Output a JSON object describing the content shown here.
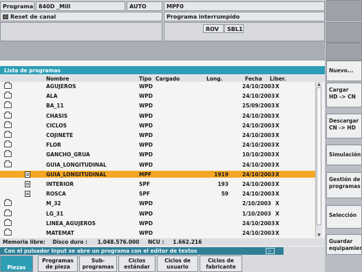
{
  "header": {
    "label_programa": "Programa",
    "machine": "840D _Mill",
    "mode": "AUTO",
    "program_name": "MPF0",
    "channel_reset": "Reset de canal",
    "status": "Programa interrumpido",
    "flag_rov": "ROV",
    "flag_sbl": "SBL1"
  },
  "panel": {
    "title": "Lista de programas",
    "columns": [
      "Nombre",
      "Tipo",
      "Cargado",
      "Long.",
      "Fecha",
      "Liber."
    ],
    "rows": [
      {
        "name": "AGUJEROS",
        "type": "WPD",
        "loaded": "",
        "length": "",
        "date": "24/10/2003",
        "release": "X",
        "kind": "folder"
      },
      {
        "name": "ALA",
        "type": "WPD",
        "loaded": "",
        "length": "",
        "date": "24/10/2003",
        "release": "X",
        "kind": "folder"
      },
      {
        "name": "BA_11",
        "type": "WPD",
        "loaded": "",
        "length": "",
        "date": "25/09/2003",
        "release": "X",
        "kind": "folder"
      },
      {
        "name": "CHASIS",
        "type": "WPD",
        "loaded": "",
        "length": "",
        "date": "24/10/2003",
        "release": "X",
        "kind": "folder"
      },
      {
        "name": "CICLOS",
        "type": "WPD",
        "loaded": "",
        "length": "",
        "date": "24/10/2003",
        "release": "X",
        "kind": "folder"
      },
      {
        "name": "COJINETE",
        "type": "WPD",
        "loaded": "",
        "length": "",
        "date": "24/10/2003",
        "release": "X",
        "kind": "folder"
      },
      {
        "name": "FLOR",
        "type": "WPD",
        "loaded": "",
        "length": "",
        "date": "24/10/2003",
        "release": "X",
        "kind": "folder"
      },
      {
        "name": "GANCHO_GRUA",
        "type": "WPD",
        "loaded": "",
        "length": "",
        "date": "10/10/2003",
        "release": "X",
        "kind": "folder"
      },
      {
        "name": "GUIA_LONGITUDINAL",
        "type": "WPD",
        "loaded": "",
        "length": "",
        "date": "24/10/2003",
        "release": "X",
        "kind": "folder-open"
      },
      {
        "name": "GUIA_LONGITUDINAL",
        "type": "MPF",
        "loaded": "",
        "length": "1919",
        "date": "24/10/2003",
        "release": "X",
        "kind": "file",
        "selected": true
      },
      {
        "name": "INTERIOR",
        "type": "SPF",
        "loaded": "",
        "length": "193",
        "date": "24/10/2003",
        "release": "X",
        "kind": "file"
      },
      {
        "name": "ROSCA",
        "type": "SPF",
        "loaded": "",
        "length": "59",
        "date": "24/10/2003",
        "release": "X",
        "kind": "file"
      },
      {
        "name": "M_32",
        "type": "WPD",
        "loaded": "",
        "length": "",
        "date": "2/10/2003",
        "release": "X",
        "kind": "folder"
      },
      {
        "name": "LG_31",
        "type": "WPD",
        "loaded": "",
        "length": "",
        "date": "1/10/2003",
        "release": "X",
        "kind": "folder"
      },
      {
        "name": "LINEA_AGUJEROS",
        "type": "WPD",
        "loaded": "",
        "length": "",
        "date": "24/10/2003",
        "release": "X",
        "kind": "folder"
      },
      {
        "name": "MATEMAT",
        "type": "WPD",
        "loaded": "",
        "length": "",
        "date": "24/10/2003",
        "release": "X",
        "kind": "folder"
      }
    ],
    "memory": {
      "label": "Memoria libre:",
      "disk_label": "Disco duro :",
      "disk_value": "1.048.576.000",
      "ncu_label": "NCU :",
      "ncu_value": "1.662.216"
    }
  },
  "hint": "Con el pulsador Input se abre un programa con el editor de textos",
  "softkeys_right": [
    {
      "label": "Nuevo..."
    },
    {
      "label": "Cargar\nHD -> CN"
    },
    {
      "label": "Descargar\nCN -> HD"
    },
    {
      "label": "Simulación"
    },
    {
      "label": "Gestión de\nprogramas"
    },
    {
      "label": "Selección"
    },
    {
      "label": "Guardar\nequipamiento"
    }
  ],
  "softkeys_bottom": [
    {
      "label": "Piezas",
      "active": true
    },
    {
      "label": "Programas\nde pieza"
    },
    {
      "label": "Sub-\nprogramas"
    },
    {
      "label": "Ciclos\nestándar"
    },
    {
      "label": "Ciclos de\nusuario"
    },
    {
      "label": "Ciclos de\nfabricante"
    }
  ],
  "colors": {
    "accent": "#2e9db6",
    "selection": "#f5a623"
  }
}
